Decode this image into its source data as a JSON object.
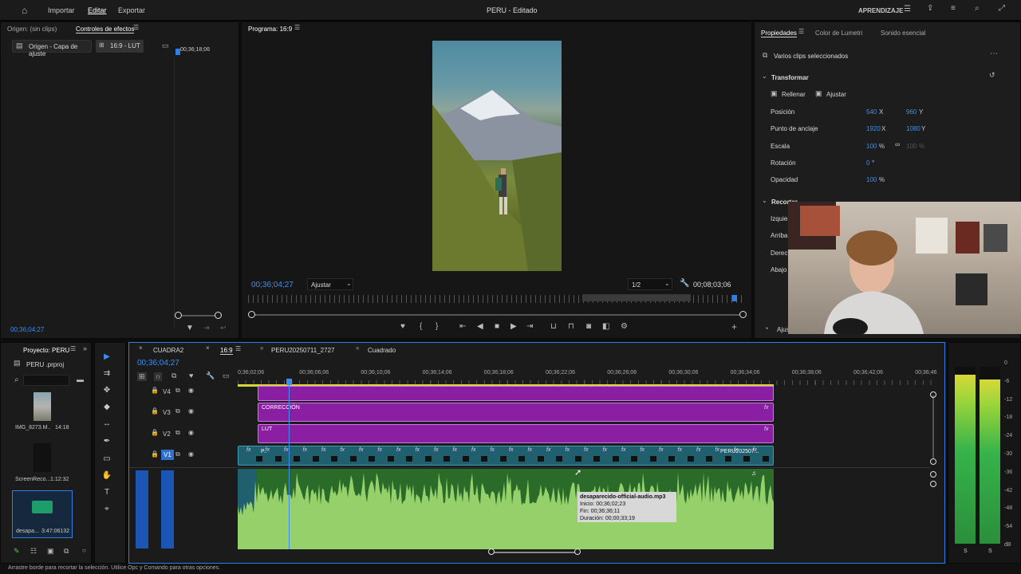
{
  "topbar": {
    "home_icon": "home-icon",
    "menus": [
      "Importar",
      "Editar",
      "Exportar"
    ],
    "title": "PERU - Editado",
    "workspace": "APRENDIZAJE"
  },
  "effects_panel": {
    "tab_source": "Origen: (sin clips)",
    "tab_effects": "Controles de efectos",
    "src_chip": "Origen - Capa de ajuste",
    "seq_chip": "16:9 - LUT",
    "timecode_small": "00;36;18;06",
    "bottom_timecode": "00;36;04;27"
  },
  "program": {
    "title": "Programa: 16:9",
    "timecode": "00;36;04;27",
    "fit": "Ajustar",
    "resolution": "1/2",
    "duration": "00;08;03;06"
  },
  "properties": {
    "tabs": [
      "Propiedades",
      "Color de Lumetri",
      "Sonido esencial"
    ],
    "selection": "Varios clips seleccionados",
    "transform": "Transformar",
    "fill": "Rellenar",
    "fit": "Ajustar",
    "rows": [
      {
        "label": "Posición",
        "v1": "540",
        "u1": "X",
        "v2": "960",
        "u2": "Y"
      },
      {
        "label": "Punto de anclaje",
        "v1": "1920",
        "u1": "X",
        "v2": "1080",
        "u2": "Y"
      },
      {
        "label": "Escala",
        "v1": "100",
        "u1": "%",
        "v2": "100",
        "u2": "%"
      },
      {
        "label": "Rotación",
        "v1": "0",
        "u1": "°",
        "v2": "",
        "u2": ""
      },
      {
        "label": "Opacidad",
        "v1": "100",
        "u1": "%",
        "v2": "",
        "u2": ""
      }
    ],
    "crop": "Recortar",
    "crop_rows": [
      "Izquier",
      "Arriba",
      "Derech",
      "Abajo"
    ],
    "adjust": "Ajus"
  },
  "project": {
    "title": "Proyecto: PERU",
    "file": "PERU .prproj",
    "items": [
      {
        "name": "IMG_8273.M..",
        "dur": "14:18"
      },
      {
        "name": "ScreenReco...",
        "dur": "1:12:32"
      },
      {
        "name": "desapa...",
        "dur": "3:47:06132"
      }
    ]
  },
  "timeline": {
    "tabs": [
      "CUADRA2",
      "16:9",
      "PERU20250711_2727",
      "Cuadrado"
    ],
    "timecode": "00;36;04;27",
    "ruler": [
      "0;36;02;06",
      "00;36;06;06",
      "00;36;10;06",
      "00;36;14;06",
      "00;36;18;06",
      "00;36;22;06",
      "00;36;26;06",
      "00;36;30;06",
      "00;36;34;06",
      "00;36;38;06",
      "00;36;42;06",
      "00;36;46"
    ],
    "tracks": [
      "V4",
      "V3",
      "V2",
      "V1"
    ],
    "clip_v3": "CORRECCIÓN",
    "clip_v2": "LUT",
    "clip_v1_start": "P..",
    "clip_v1_end": "PERU202507...",
    "tooltip": {
      "name": "desaparecido-official-audio.mp3",
      "start": "Inicio: 00;36;02;23",
      "end": "Fin: 00;36;36;11",
      "dur": "Duración: 00;00;33;19"
    }
  },
  "meter": {
    "scale": [
      "0",
      "-6",
      "-12",
      "-18",
      "-24",
      "-30",
      "-36",
      "-42",
      "-48",
      "-54",
      "dB"
    ],
    "ch": [
      "S",
      "S"
    ]
  },
  "status": "Arrastre borde para recortar la selección. Utilice Opc y Comando para otras opciones."
}
